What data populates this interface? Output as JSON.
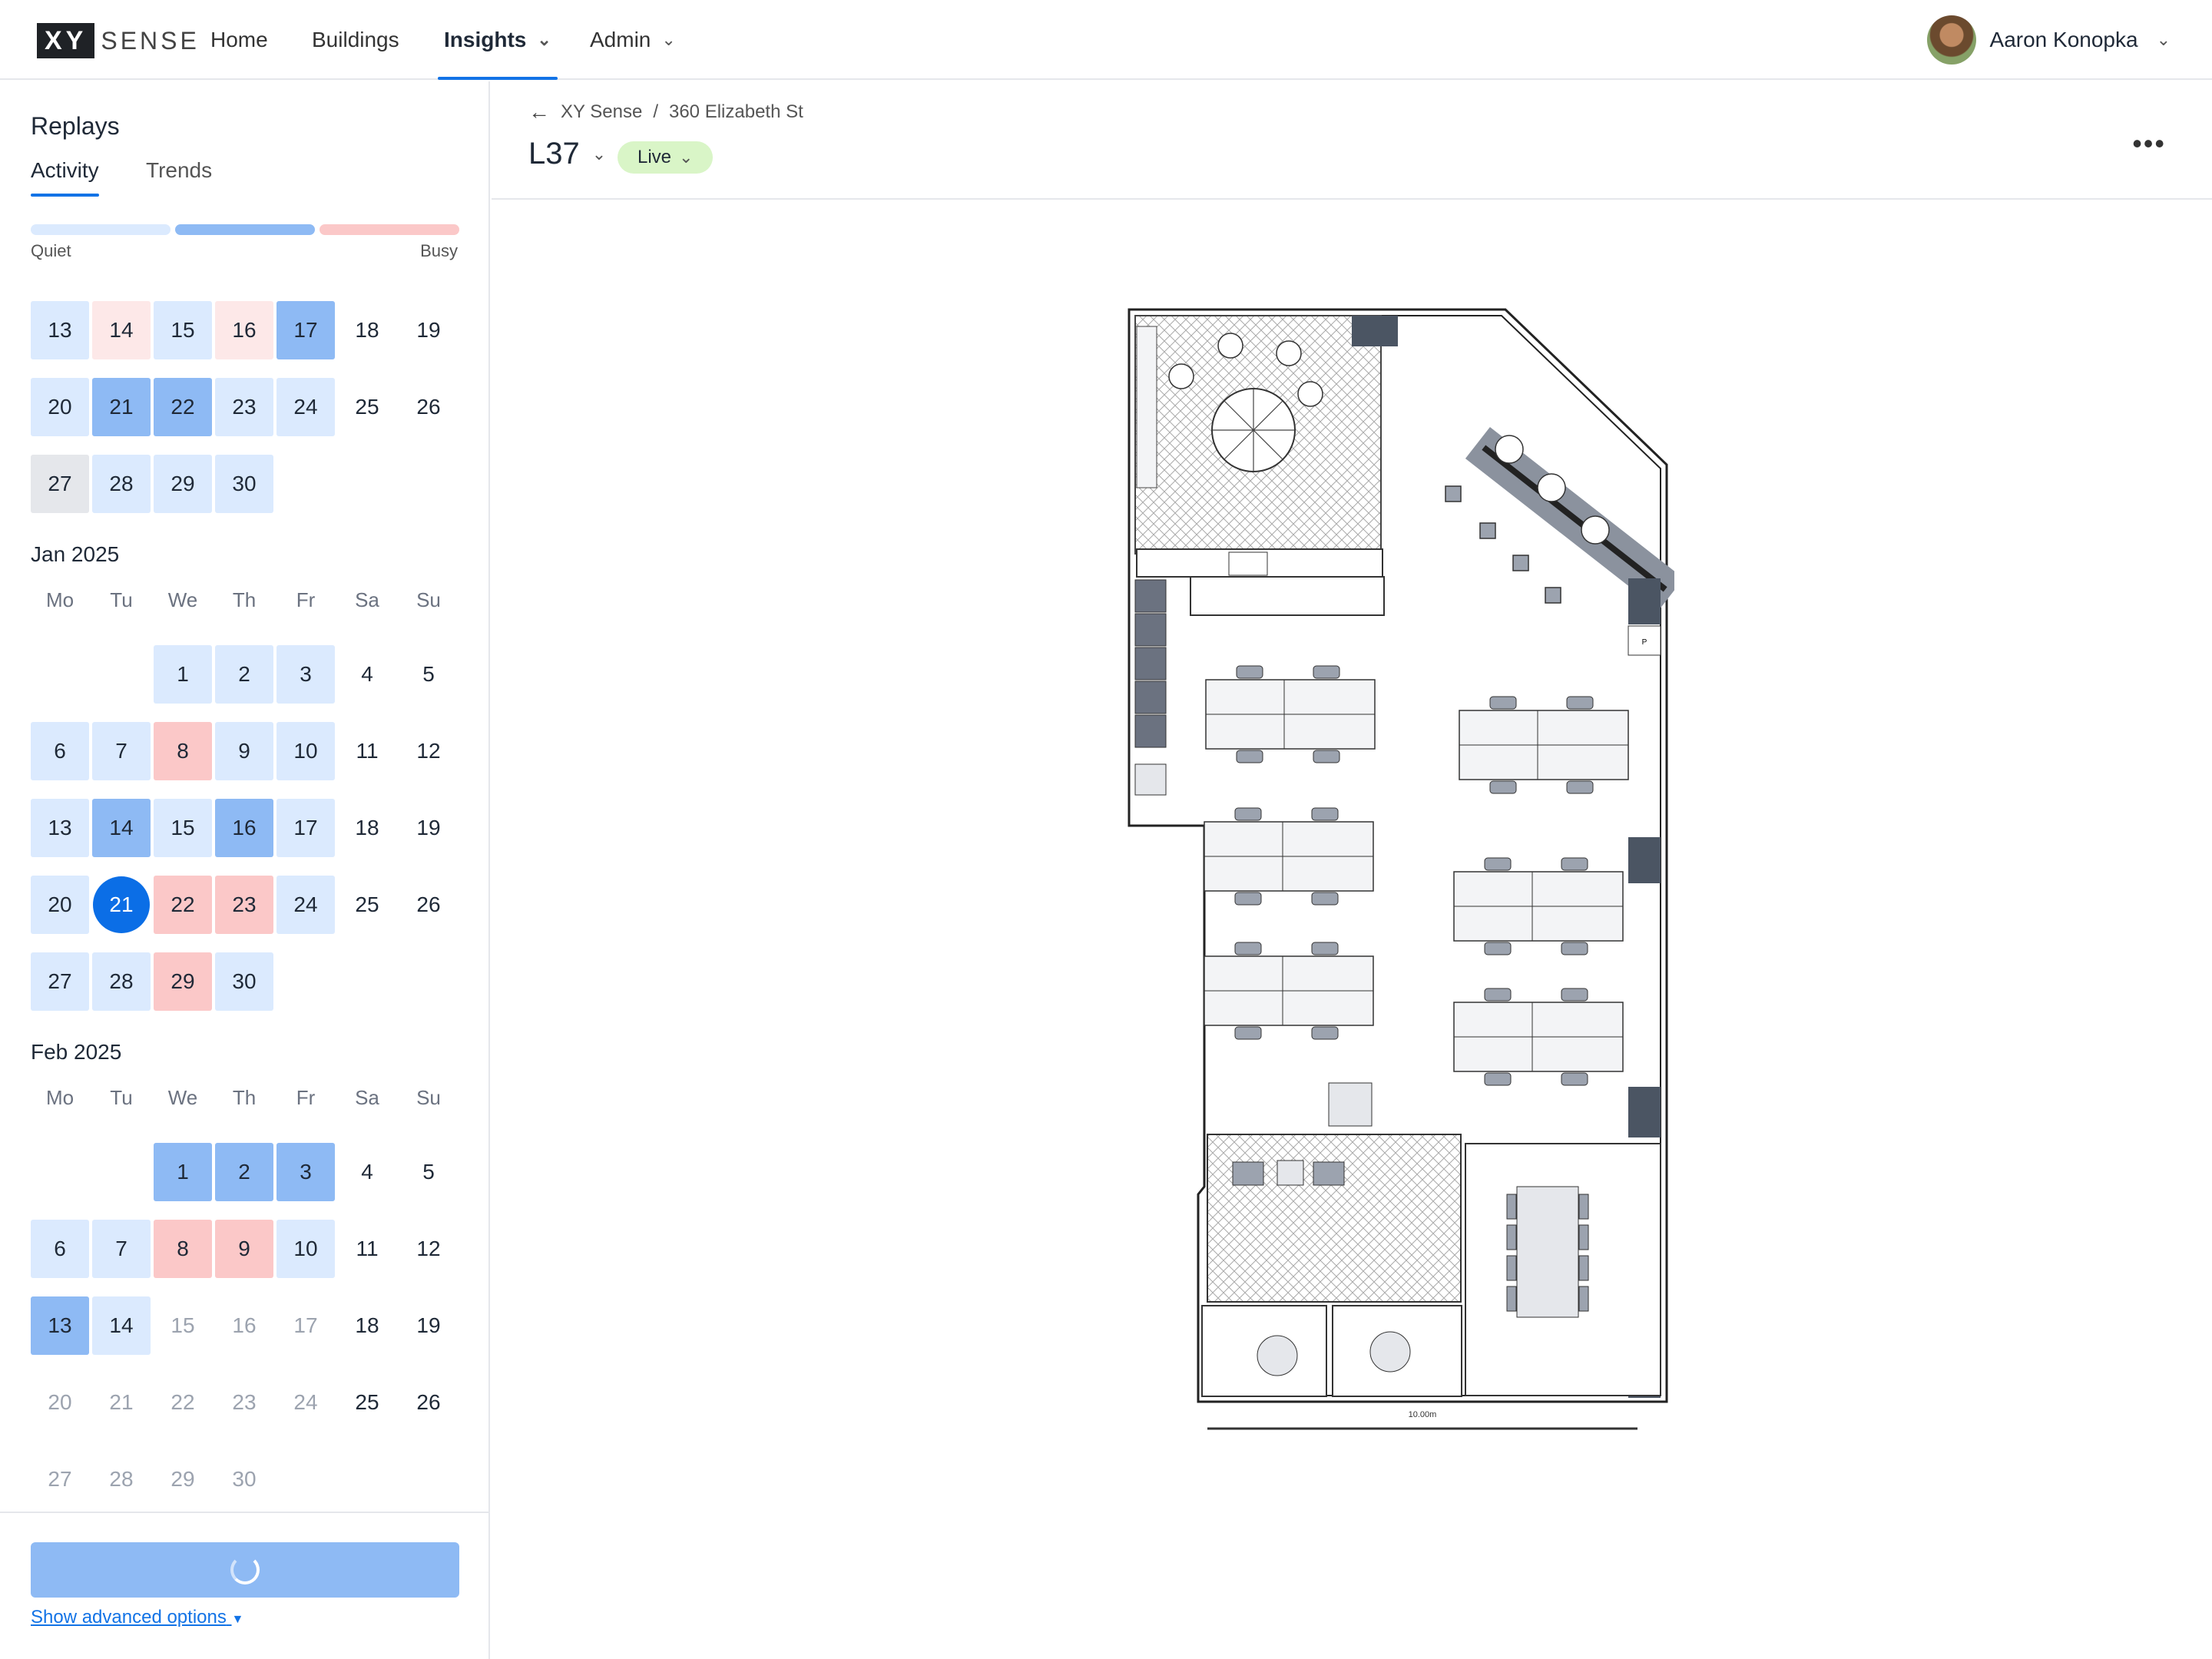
{
  "nav": {
    "logo_box": "XY",
    "logo_rest": "SENSE",
    "home": "Home",
    "buildings": "Buildings",
    "insights": "Insights",
    "admin": "Admin",
    "user_name": "Aaron Konopka"
  },
  "sidebar": {
    "title": "Replays",
    "tab_activity": "Activity",
    "tab_trends": "Trends",
    "legend_quiet": "Quiet",
    "legend_busy": "Busy",
    "dow": [
      "Mo",
      "Tu",
      "We",
      "Th",
      "Fr",
      "Sa",
      "Su"
    ],
    "dec_weeks": [
      [
        [
          "13",
          "c1"
        ],
        [
          "14",
          "c3"
        ],
        [
          "15",
          "c1"
        ],
        [
          "16",
          "c3"
        ],
        [
          "17",
          "c2"
        ],
        [
          "18",
          "c0"
        ],
        [
          "19",
          "c0"
        ]
      ],
      [
        [
          "20",
          "c1"
        ],
        [
          "21",
          "c2"
        ],
        [
          "22",
          "c2"
        ],
        [
          "23",
          "c1"
        ],
        [
          "24",
          "c1"
        ],
        [
          "25",
          "c0"
        ],
        [
          "26",
          "c0"
        ]
      ],
      [
        [
          "27",
          "cg"
        ],
        [
          "28",
          "c1"
        ],
        [
          "29",
          "c1"
        ],
        [
          "30",
          "c1"
        ],
        [
          "",
          ""
        ],
        [
          "",
          ""
        ],
        [
          "",
          ""
        ]
      ]
    ],
    "jan_label": "Jan 2025",
    "jan_weeks": [
      [
        [
          "",
          ""
        ],
        [
          "",
          ""
        ],
        [
          "1",
          "c1"
        ],
        [
          "2",
          "c1"
        ],
        [
          "3",
          "c1"
        ],
        [
          "4",
          "c0"
        ],
        [
          "5",
          "c0"
        ]
      ],
      [
        [
          "6",
          "c1"
        ],
        [
          "7",
          "c1"
        ],
        [
          "8",
          "c4"
        ],
        [
          "9",
          "c1"
        ],
        [
          "10",
          "c1"
        ],
        [
          "11",
          "c0"
        ],
        [
          "12",
          "c0"
        ]
      ],
      [
        [
          "13",
          "c1"
        ],
        [
          "14",
          "c2"
        ],
        [
          "15",
          "c1"
        ],
        [
          "16",
          "c2"
        ],
        [
          "17",
          "c1"
        ],
        [
          "18",
          "c0"
        ],
        [
          "19",
          "c0"
        ]
      ],
      [
        [
          "20",
          "c1"
        ],
        [
          "21",
          "sel"
        ],
        [
          "22",
          "c4"
        ],
        [
          "23",
          "c4"
        ],
        [
          "24",
          "c1"
        ],
        [
          "25",
          "c0"
        ],
        [
          "26",
          "c0"
        ]
      ],
      [
        [
          "27",
          "c1"
        ],
        [
          "28",
          "c1"
        ],
        [
          "29",
          "c4"
        ],
        [
          "30",
          "c1"
        ],
        [
          "",
          ""
        ],
        [
          "",
          ""
        ],
        [
          "",
          ""
        ]
      ]
    ],
    "feb_label": "Feb 2025",
    "feb_weeks": [
      [
        [
          "",
          ""
        ],
        [
          "",
          ""
        ],
        [
          "1",
          "c2"
        ],
        [
          "2",
          "c2"
        ],
        [
          "3",
          "c2"
        ],
        [
          "4",
          "c0"
        ],
        [
          "5",
          "c0"
        ]
      ],
      [
        [
          "6",
          "c1"
        ],
        [
          "7",
          "c1"
        ],
        [
          "8",
          "c4"
        ],
        [
          "9",
          "c4"
        ],
        [
          "10",
          "c1"
        ],
        [
          "11",
          "c0"
        ],
        [
          "12",
          "c0"
        ]
      ],
      [
        [
          "13",
          "c2"
        ],
        [
          "14",
          "c1"
        ],
        [
          "15",
          "cf"
        ],
        [
          "16",
          "cf"
        ],
        [
          "17",
          "cf"
        ],
        [
          "18",
          "c0"
        ],
        [
          "19",
          "c0"
        ]
      ],
      [
        [
          "20",
          "cf"
        ],
        [
          "21",
          "cf"
        ],
        [
          "22",
          "cf"
        ],
        [
          "23",
          "cf"
        ],
        [
          "24",
          "cf"
        ],
        [
          "25",
          "c0"
        ],
        [
          "26",
          "c0"
        ]
      ],
      [
        [
          "27",
          "cf"
        ],
        [
          "28",
          "cf"
        ],
        [
          "29",
          "cf"
        ],
        [
          "30",
          "cf"
        ],
        [
          "",
          ""
        ],
        [
          "",
          ""
        ],
        [
          "",
          ""
        ]
      ]
    ],
    "advanced": "Show advanced options"
  },
  "header": {
    "crumb_org": "XY Sense",
    "crumb_sep": "/",
    "crumb_building": "360 Elizabeth St",
    "floor": "L37",
    "live": "Live",
    "more": "•••"
  },
  "plan": {
    "scale": "10.00m",
    "marker": "P"
  },
  "colors": {
    "accent": "#1273e6",
    "live_bg": "#d9f5c7",
    "quiet": "#dbeafe",
    "medium": "#8ebaf4",
    "busy": "#fbc8c8"
  }
}
